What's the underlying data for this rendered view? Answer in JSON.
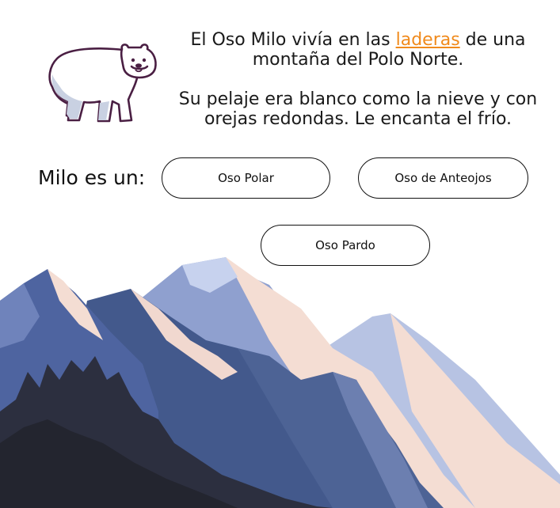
{
  "story": {
    "line1_before": "El Oso Milo vivía en las ",
    "line1_highlight": "laderas",
    "line1_after": " de una montaña del Polo Norte.",
    "line2": "Su pelaje era blanco como la nieve y con orejas redondas. Le encanta el frío."
  },
  "question": "Milo es un:",
  "options": [
    "Oso Polar",
    "Oso de Anteojos",
    "Oso Pardo"
  ],
  "colors": {
    "highlight": "#f08a1c",
    "bear_outline": "#4a1f43",
    "mountain_dark": "#2c2f3f",
    "mountain_mid": "#3f5585",
    "mountain_light": "#8a9bc9",
    "snow_pink": "#f4ddd3"
  }
}
